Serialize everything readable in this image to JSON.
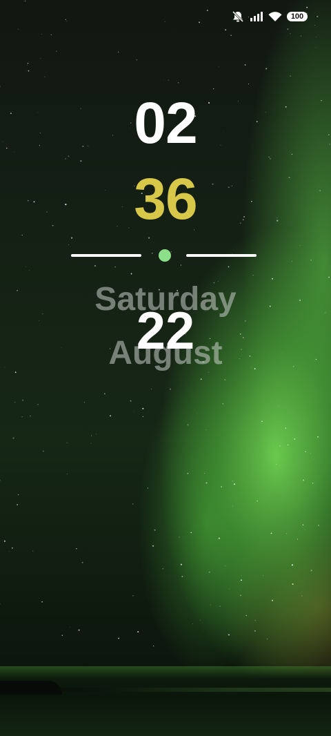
{
  "status_bar": {
    "icons": [
      "bell-muted-icon",
      "cellular-signal-icon",
      "wifi-icon"
    ],
    "battery_level": "100"
  },
  "clock": {
    "hour": "02",
    "minute": "36"
  },
  "date": {
    "weekday": "Saturday",
    "day": "22",
    "month": "August"
  },
  "colors": {
    "hour": "#ffffff",
    "minute": "#d8c84a",
    "accent_dot": "#8ce08a",
    "date_text": "#c8cdc8"
  }
}
